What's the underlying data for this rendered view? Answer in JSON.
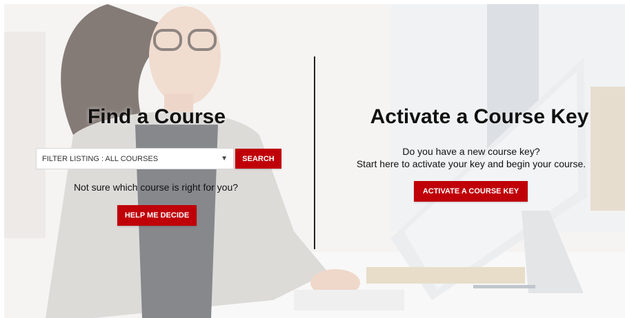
{
  "find": {
    "title": "Find a Course",
    "filter_value": "FILTER LISTING : ALL COURSES",
    "search_label": "SEARCH",
    "prompt": "Not sure which course is right for you?",
    "help_label": "HELP ME DECIDE"
  },
  "activate": {
    "title": "Activate a Course Key",
    "line1": "Do you have a new course key?",
    "line2": "Start here to activate your key and begin your course.",
    "button_label": "ACTIVATE A COURSE KEY"
  },
  "icons": {
    "select_arrow": "▼"
  },
  "colors": {
    "accent_red": "#c00008",
    "heading_text": "#111111"
  }
}
